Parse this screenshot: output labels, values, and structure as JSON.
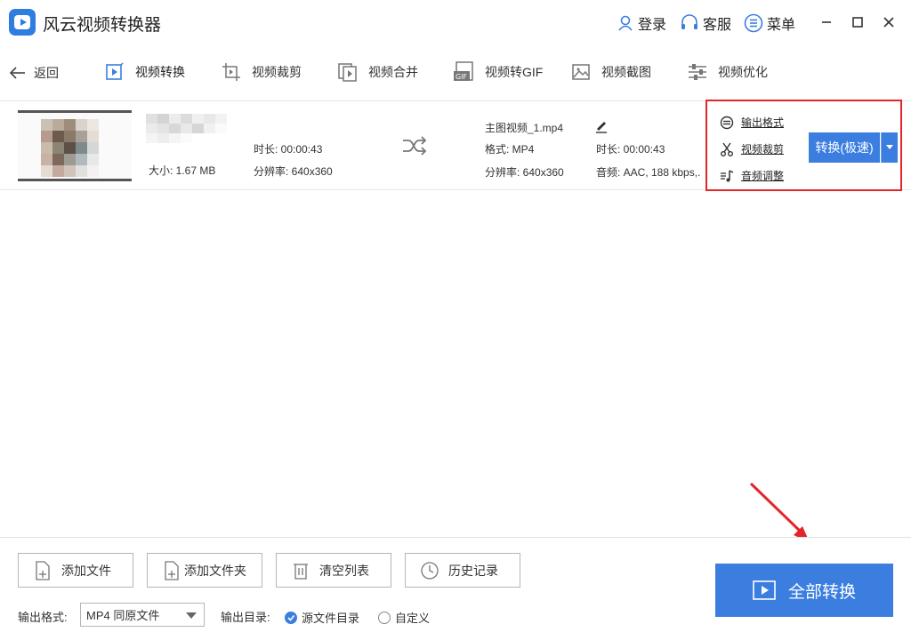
{
  "app": {
    "title": "风云视频转换器",
    "login_label": "登录",
    "service_label": "客服",
    "menu_label": "菜单"
  },
  "toolbar": {
    "back_label": "返回",
    "tools": [
      {
        "label": "视频转换",
        "icon": "video-convert-icon"
      },
      {
        "label": "视频裁剪",
        "icon": "video-crop-icon"
      },
      {
        "label": "视频合并",
        "icon": "video-merge-icon"
      },
      {
        "label": "视频转GIF",
        "icon": "gif-icon"
      },
      {
        "label": "视频截图",
        "icon": "screenshot-icon"
      },
      {
        "label": "视频优化",
        "icon": "optimize-icon"
      }
    ]
  },
  "file": {
    "size": "大小: 1.67 MB",
    "duration": "时长: 00:00:43",
    "resolution": "分辨率: 640x360",
    "output_name": "主图视频_1.mp4",
    "output_format": "格式: MP4",
    "output_duration": "时长: 00:00:43",
    "output_resolution": "分辨率: 640x360",
    "output_audio": "音频: AAC, 188 kbps,..."
  },
  "options": {
    "output_format": "输出格式",
    "video_crop": "视频裁剪",
    "audio_adjust": "音频调整",
    "convert_label": "转换(极速)"
  },
  "bottom": {
    "add_file": "添加文件",
    "add_folder": "添加文件夹",
    "clear_list": "清空列表",
    "history": "历史记录",
    "format_label": "输出格式:",
    "format_value": "MP4 同原文件",
    "dir_label": "输出目录:",
    "radio_source": "源文件目录",
    "radio_custom": "自定义",
    "convert_all": "全部转换"
  },
  "colors": {
    "accent": "#3b7ee0",
    "highlight": "#e3242b"
  }
}
